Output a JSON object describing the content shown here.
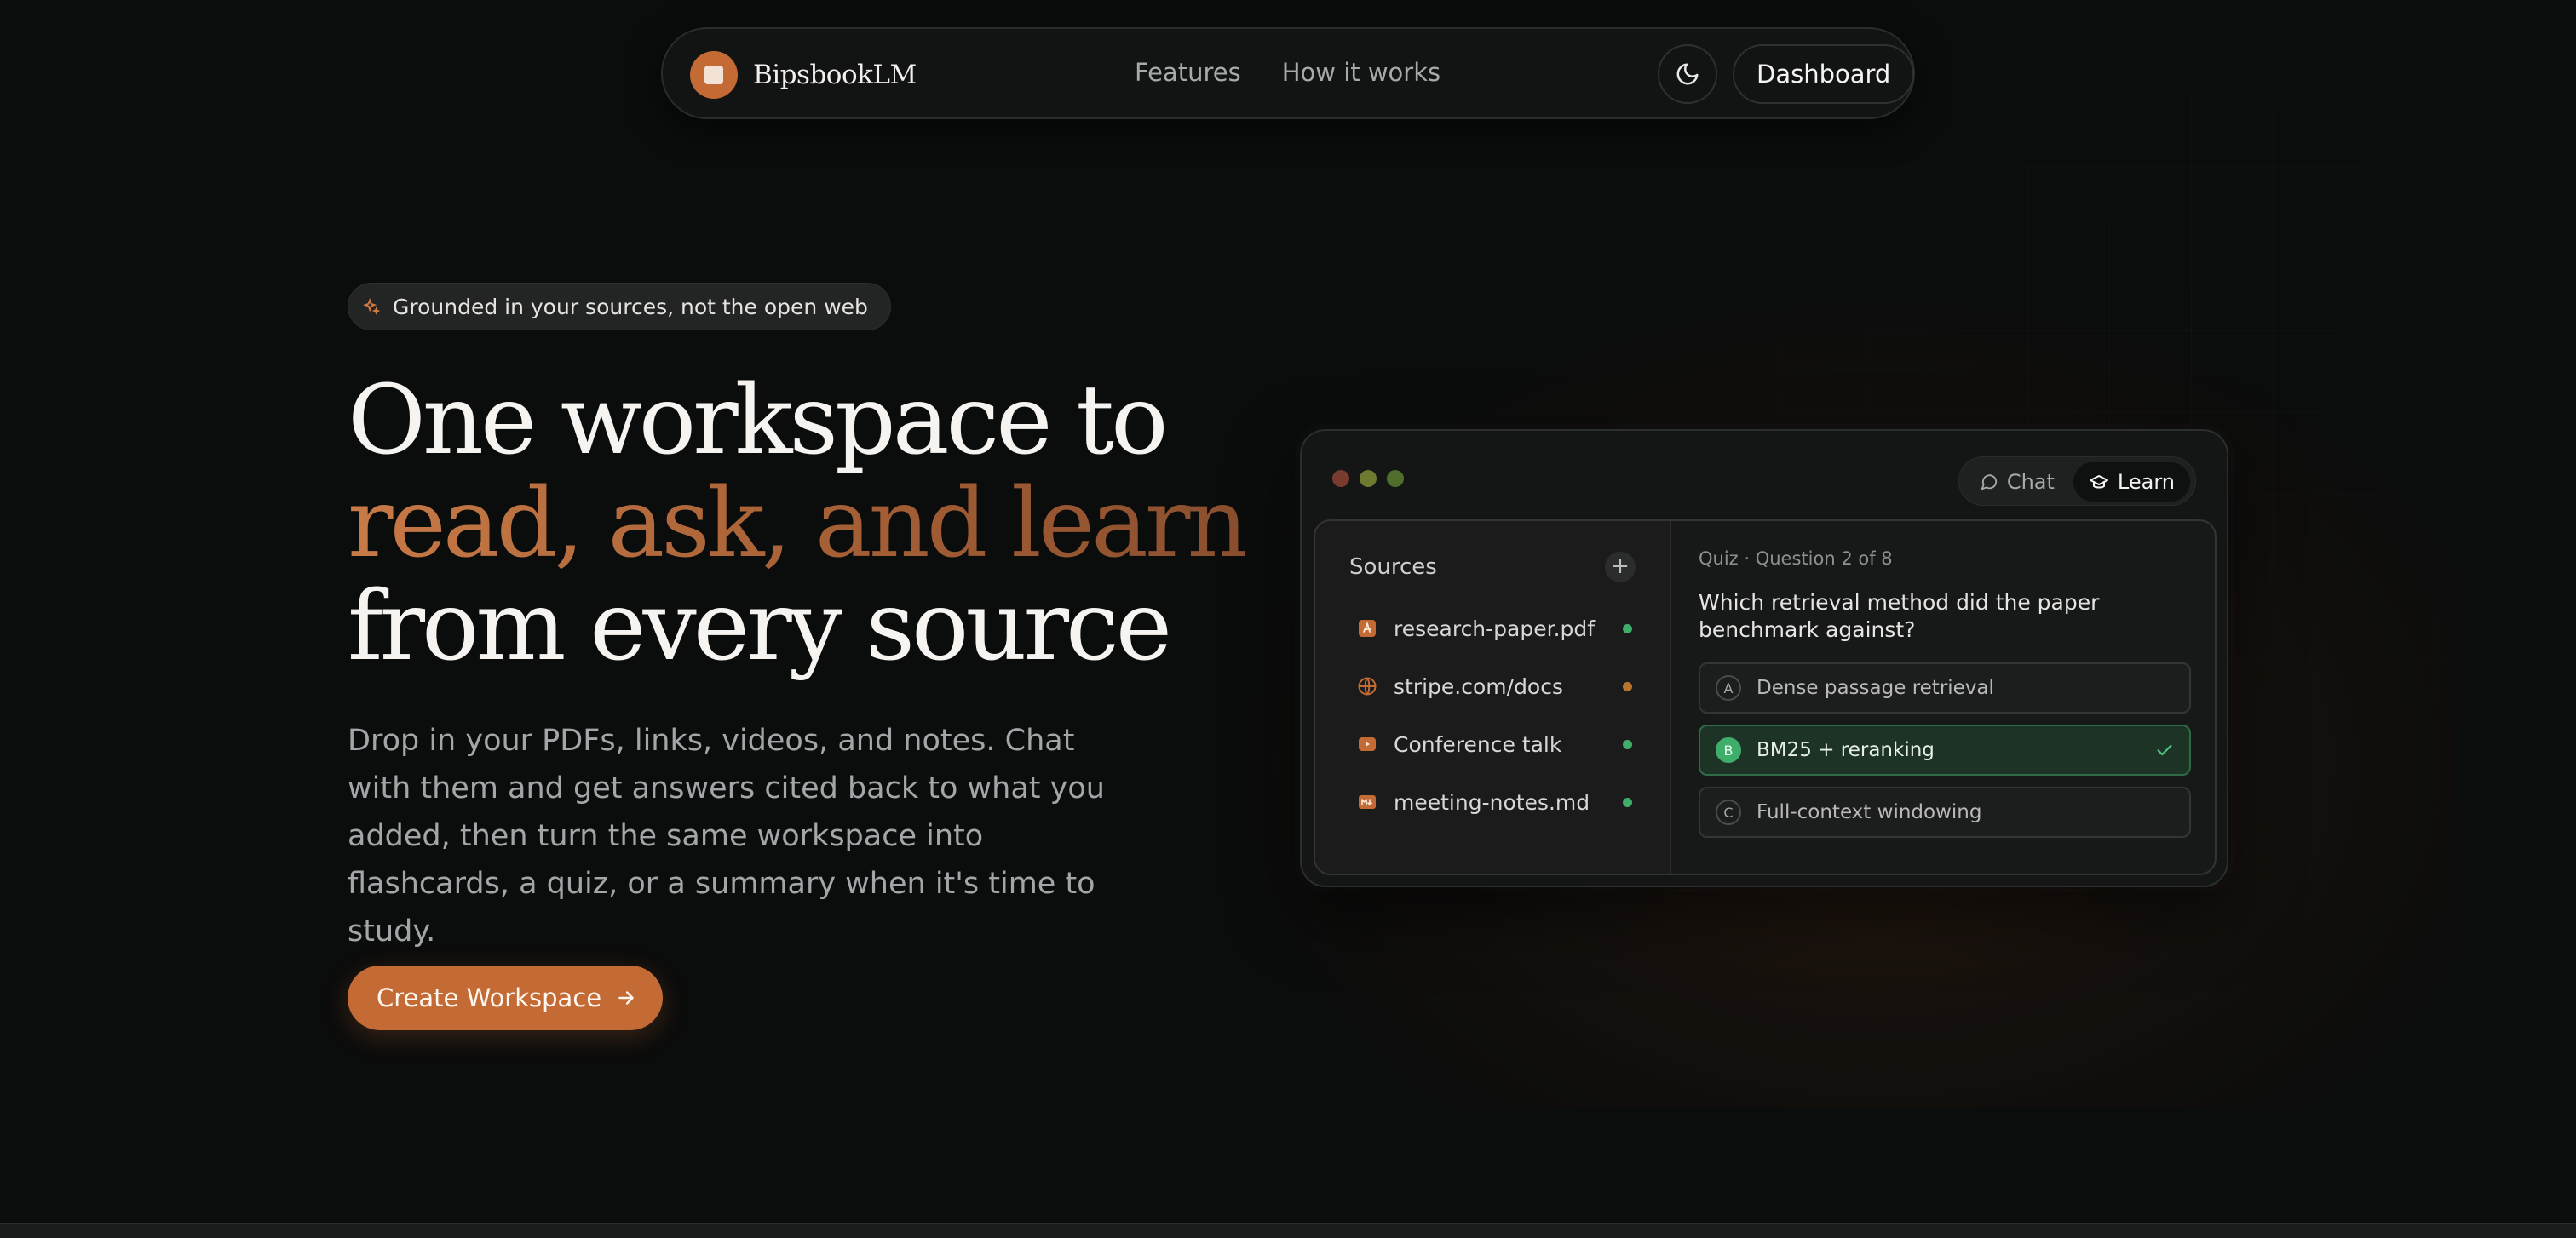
{
  "nav": {
    "brand": "BipsbookLM",
    "links": [
      "Features",
      "How it works"
    ],
    "theme_icon": "moon-icon",
    "dashboard_label": "Dashboard"
  },
  "hero": {
    "badge_icon": "sparkles-icon",
    "badge": "Grounded in your sources, not the open web",
    "headline_line1": "One workspace to",
    "headline_line2": "read, ask, and learn",
    "headline_line3": "from every source",
    "lede": "Drop in your PDFs, links, videos, and notes. Chat with them and get answers cited back to what you added, then turn the same workspace into flashcards, a quiz, or a summary when it's time to study.",
    "cta_label": "Create Workspace",
    "cta_icon": "arrow-right-icon"
  },
  "mock": {
    "window_dots": [
      "#7a3b2f",
      "#6e7a30",
      "#4f6e2c"
    ],
    "tabs": [
      {
        "label": "Chat",
        "icon": "chat-icon",
        "active": false
      },
      {
        "label": "Learn",
        "icon": "graduation-cap-icon",
        "active": true
      }
    ],
    "sources_title": "Sources",
    "add_label": "+",
    "sources": [
      {
        "name": "research-paper.pdf",
        "icon": "pdf-icon",
        "status_color": "#3fae6a"
      },
      {
        "name": "stripe.com/docs",
        "icon": "globe-icon",
        "status_color": "#b8752f"
      },
      {
        "name": "Conference talk",
        "icon": "video-icon",
        "status_color": "#3fae6a"
      },
      {
        "name": "meeting-notes.md",
        "icon": "markdown-icon",
        "status_color": "#3fae6a"
      }
    ],
    "quiz": {
      "meta": "Quiz · Question 2 of 8",
      "question": "Which retrieval method did the paper benchmark against?",
      "options": [
        {
          "letter": "A",
          "text": "Dense passage retrieval",
          "correct": false
        },
        {
          "letter": "B",
          "text": "BM25 + reranking",
          "correct": true
        },
        {
          "letter": "C",
          "text": "Full-context windowing",
          "correct": false
        }
      ],
      "check_icon": "check-icon"
    }
  },
  "colors": {
    "accent": "#c46a34",
    "background": "#0b0c0c",
    "success": "#3fae6a"
  }
}
